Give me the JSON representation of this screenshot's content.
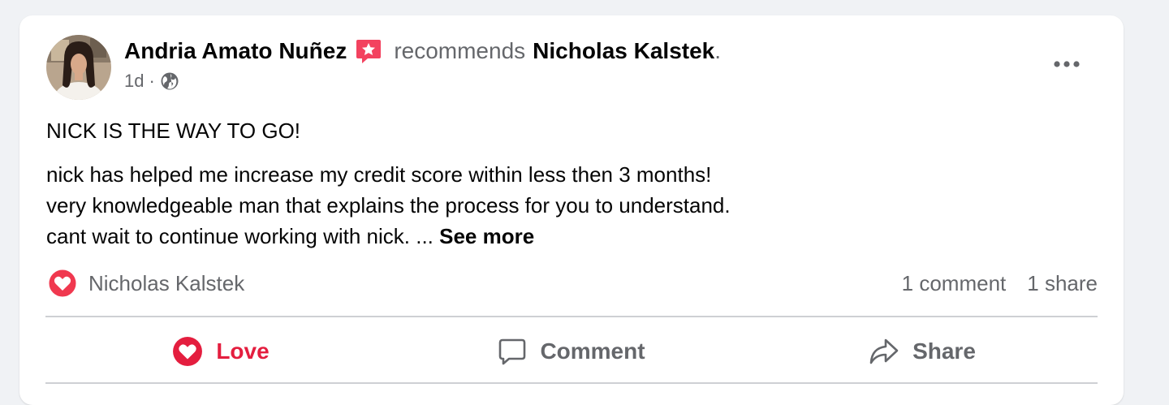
{
  "post": {
    "author_name": "Andria Amato Nuñez",
    "recommends_text": "recommends",
    "recommended_page": "Nicholas Kalstek",
    "period": ".",
    "timestamp": "1d",
    "separator": "·",
    "privacy_icon": "globe-icon",
    "more_icon": "ellipsis-icon",
    "title": "NICK IS THE WAY TO GO!",
    "body_lines": [
      "nick has helped me increase my credit score within less then 3 months!",
      "very knowledgeable man that explains the process for you to understand.",
      "cant wait to continue working with nick. ..."
    ],
    "see_more": "See more"
  },
  "reactions": {
    "icon": "love-reaction-icon",
    "names": "Nicholas Kalstek"
  },
  "counts": {
    "comments": "1 comment",
    "shares": "1 share"
  },
  "actions": {
    "love": "Love",
    "comment": "Comment",
    "share": "Share"
  },
  "colors": {
    "love_red": "#e41e3f",
    "secondary_text": "#65676b",
    "divider": "#ced0d4",
    "badge_red": "#f3425f"
  }
}
